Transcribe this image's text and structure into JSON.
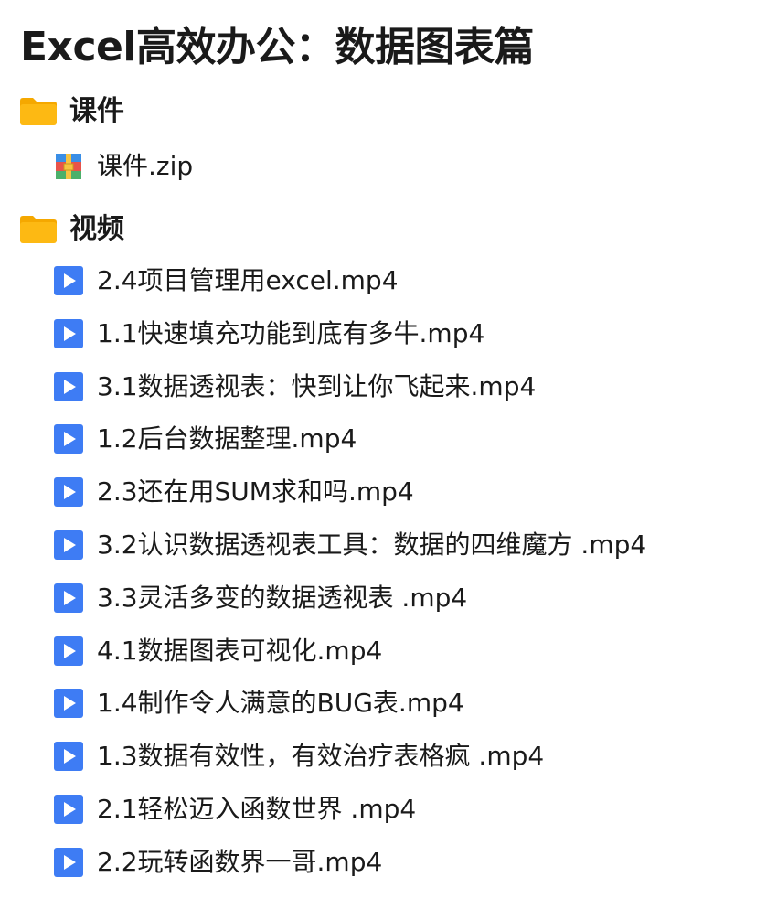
{
  "page_title": "Excel高效办公：数据图表篇",
  "folders": [
    {
      "name": "课件",
      "icon": "folder-icon",
      "files": [
        {
          "name": "课件.zip",
          "icon": "archive-icon"
        }
      ]
    },
    {
      "name": "视频",
      "icon": "folder-icon",
      "files": [
        {
          "name": "2.4项目管理用excel.mp4",
          "icon": "video-play-icon"
        },
        {
          "name": "1.1快速填充功能到底有多牛.mp4",
          "icon": "video-play-icon"
        },
        {
          "name": "3.1数据透视表：快到让你飞起来.mp4",
          "icon": "video-play-icon"
        },
        {
          "name": "1.2后台数据整理.mp4",
          "icon": "video-play-icon"
        },
        {
          "name": "2.3还在用SUM求和吗.mp4",
          "icon": "video-play-icon"
        },
        {
          "name": "3.2认识数据透视表工具：数据的四维魔方 .mp4",
          "icon": "video-play-icon"
        },
        {
          "name": "3.3灵活多变的数据透视表 .mp4",
          "icon": "video-play-icon"
        },
        {
          "name": "4.1数据图表可视化.mp4",
          "icon": "video-play-icon"
        },
        {
          "name": "1.4制作令人满意的BUG表.mp4",
          "icon": "video-play-icon"
        },
        {
          "name": "1.3数据有效性，有效治疗表格疯 .mp4",
          "icon": "video-play-icon"
        },
        {
          "name": "2.1轻松迈入函数世界 .mp4",
          "icon": "video-play-icon"
        },
        {
          "name": "2.2玩转函数界一哥.mp4",
          "icon": "video-play-icon"
        }
      ]
    }
  ],
  "colors": {
    "folder": "#FDB913",
    "folder_tab": "#F5A800",
    "video_icon": "#3E7CF4",
    "archive_blue": "#3A8EE6",
    "archive_red": "#E8534A",
    "archive_green": "#4CB06A",
    "archive_yellow": "#F6C342",
    "text": "#1a1a1a"
  }
}
